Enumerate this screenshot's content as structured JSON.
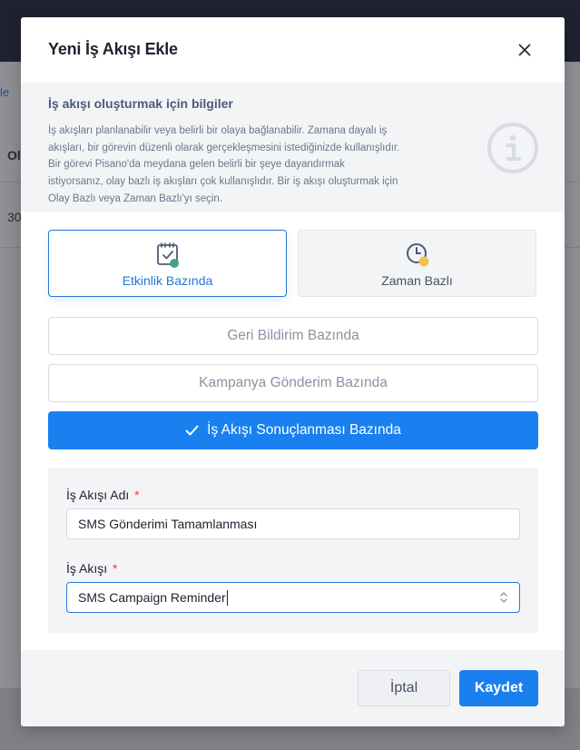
{
  "background": {
    "link_text": "le",
    "column_header": "Ol",
    "cell_value": "30"
  },
  "modal": {
    "title": "Yeni İş Akışı Ekle",
    "close_icon": "close-icon",
    "info": {
      "title": "İş akışı oluşturmak için bilgiler",
      "lines": [
        "İş akışları planlanabilir veya belirli bir olaya bağlanabilir. Zamana dayalı iş",
        "akışları, bir görevin düzenli olarak gerçekleşmesini istediğinizde kullanışlıdır.",
        "Bir görevi Pisano'da meydana gelen belirli bir şeye dayandırmak",
        "istiyorsanız, olay bazlı iş akışları çok kullanışlıdır. Bir iş akışı oluşturmak için",
        "Olay Bazlı veya Zaman Bazlı'yı seçin."
      ],
      "icon": "info-icon"
    },
    "type_cards": {
      "activity": {
        "label": "Etkinlik Bazında",
        "icon": "calendar-check-icon",
        "selected": true
      },
      "time": {
        "label": "Zaman Bazlı",
        "icon": "clock-icon",
        "selected": false
      }
    },
    "options": {
      "feedback": "Geri Bildirim Bazında",
      "campaign": "Kampanya Gönderim Bazında",
      "workflow_result": "İş Akışı Sonuçlanması Bazında"
    },
    "form": {
      "name_label": "İş Akışı Adı",
      "name_value": "SMS Gönderimi Tamamlanması",
      "flow_label": "İş Akışı",
      "flow_value": "SMS Campaign Reminder",
      "required_mark": "*"
    },
    "footer": {
      "cancel_label": "İptal",
      "save_label": "Kaydet"
    }
  },
  "colors": {
    "primary": "#1a80f0",
    "accent_border": "#2476d6",
    "required": "#e43b3b",
    "panel_bg": "#f3f4f6",
    "overlay_topbar": "#1f2230"
  }
}
